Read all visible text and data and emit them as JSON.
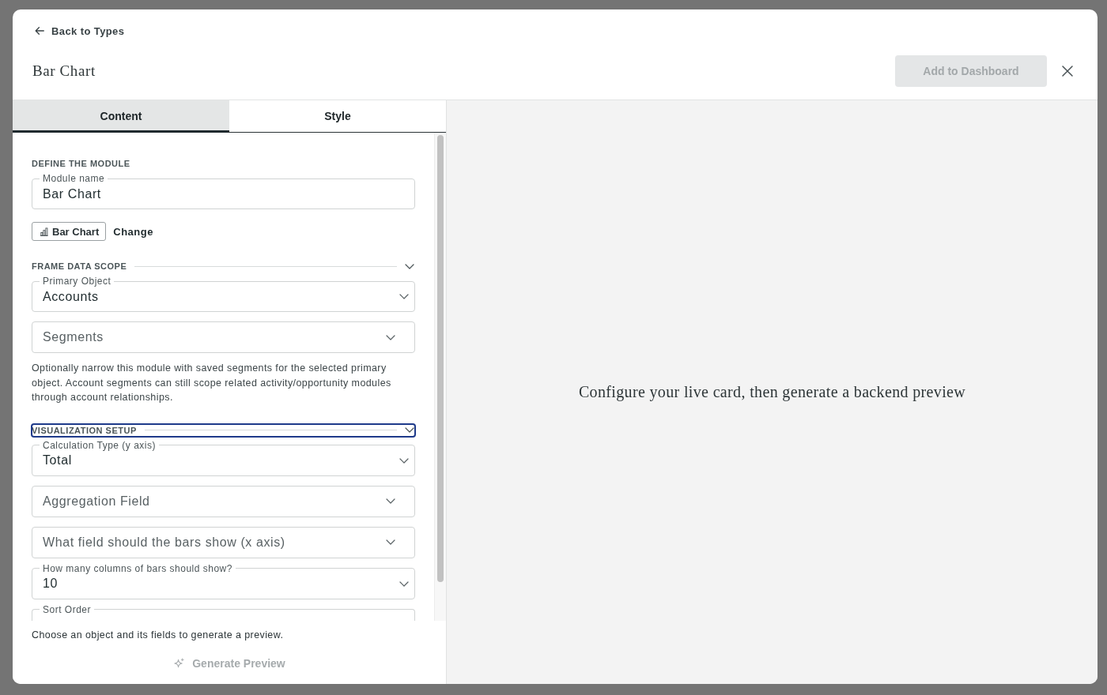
{
  "header": {
    "back_link": "Back to Types",
    "title": "Bar Chart",
    "add_button": {
      "label": "Add to Dashboard",
      "disabled": true
    }
  },
  "tabs": [
    {
      "label": "Content",
      "selected": true
    },
    {
      "label": "Style",
      "selected": false
    }
  ],
  "sections": [
    {
      "kind": "plain",
      "title": "DEFINE THE MODULE",
      "items": [
        {
          "kind": "input",
          "label": "Module name",
          "value": "Bar Chart"
        },
        {
          "kind": "type-chip",
          "label": "Bar Chart",
          "action": "Change"
        }
      ]
    },
    {
      "kind": "collapsible",
      "title": "FRAME DATA SCOPE",
      "expanded": true,
      "focused": false,
      "items": [
        {
          "kind": "select",
          "label": "Primary Object",
          "value": "Accounts"
        },
        {
          "kind": "select",
          "placeholder": "Segments"
        },
        {
          "kind": "note",
          "text": "Optionally narrow this module with saved segments for the selected primary object. Account segments can still scope related activity/opportunity modules through account relationships."
        }
      ]
    },
    {
      "kind": "collapsible",
      "title": "VISUALIZATION SETUP",
      "expanded": true,
      "focused": true,
      "items": [
        {
          "kind": "select",
          "label": "Calculation Type (y axis)",
          "value": "Total"
        },
        {
          "kind": "select",
          "placeholder": "Aggregation Field"
        },
        {
          "kind": "select",
          "placeholder": "What field should the bars show (x axis)"
        },
        {
          "kind": "select",
          "label": "How many columns of bars should show?",
          "value": "10"
        },
        {
          "kind": "select",
          "label": "Sort Order"
        }
      ]
    }
  ],
  "footer": {
    "hint": "Choose an object and its fields to generate a preview.",
    "generate_button": {
      "label": "Generate Preview",
      "disabled": true
    }
  },
  "preview": {
    "message": "Configure your live card, then generate a backend preview"
  }
}
